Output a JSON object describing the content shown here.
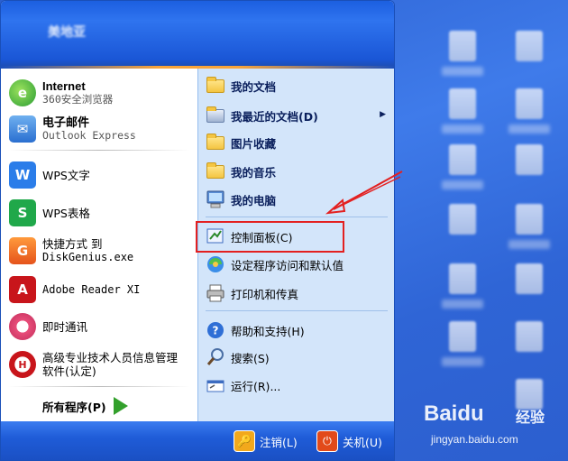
{
  "header": {
    "user_name": "美地亚"
  },
  "left_items": [
    {
      "title": "Internet",
      "subtitle": "360安全浏览器",
      "icon": "browser-icon"
    },
    {
      "title": "电子邮件",
      "subtitle": "Outlook Express",
      "icon": "email-icon"
    },
    {
      "title": "WPS文字",
      "icon": "wps-writer-icon"
    },
    {
      "title": "WPS表格",
      "icon": "wps-spreadsheet-icon"
    },
    {
      "title": "快捷方式 到",
      "subtitle": "DiskGenius.exe",
      "icon": "diskgenius-icon"
    },
    {
      "title": "Adobe Reader XI",
      "icon": "adobe-reader-icon"
    },
    {
      "title": "即时通讯",
      "icon": "instant-message-icon"
    },
    {
      "title": "高级专业技术人员信息管理",
      "subtitle": "软件(认定)",
      "icon": "hr-software-icon"
    }
  ],
  "all_programs_label": "所有程序(P)",
  "right_items": [
    {
      "label": "我的文档",
      "icon": "folder-icon"
    },
    {
      "label": "我最近的文档(D)",
      "icon": "recent-docs-icon",
      "has_submenu": true
    },
    {
      "label": "图片收藏",
      "icon": "folder-icon"
    },
    {
      "label": "我的音乐",
      "icon": "folder-icon"
    },
    {
      "label": "我的电脑",
      "icon": "my-computer-icon"
    },
    {
      "label": "控制面板(C)",
      "icon": "control-panel-icon"
    },
    {
      "label": "设定程序访问和默认值",
      "icon": "program-defaults-icon"
    },
    {
      "label": "打印机和传真",
      "icon": "printer-icon"
    },
    {
      "label": "帮助和支持(H)",
      "icon": "help-icon"
    },
    {
      "label": "搜索(S)",
      "icon": "search-icon"
    },
    {
      "label": "运行(R)...",
      "icon": "run-icon"
    }
  ],
  "footer": {
    "logoff_label": "注销(L)",
    "shutdown_label": "关机(U)"
  },
  "watermark": {
    "logo": "Baidu",
    "jingyan": "经验",
    "url": "jingyan.baidu.com"
  },
  "colors": {
    "header_blue": "#1c5fe0",
    "right_pane": "#d3e5fa",
    "highlight_red": "#e32020"
  }
}
